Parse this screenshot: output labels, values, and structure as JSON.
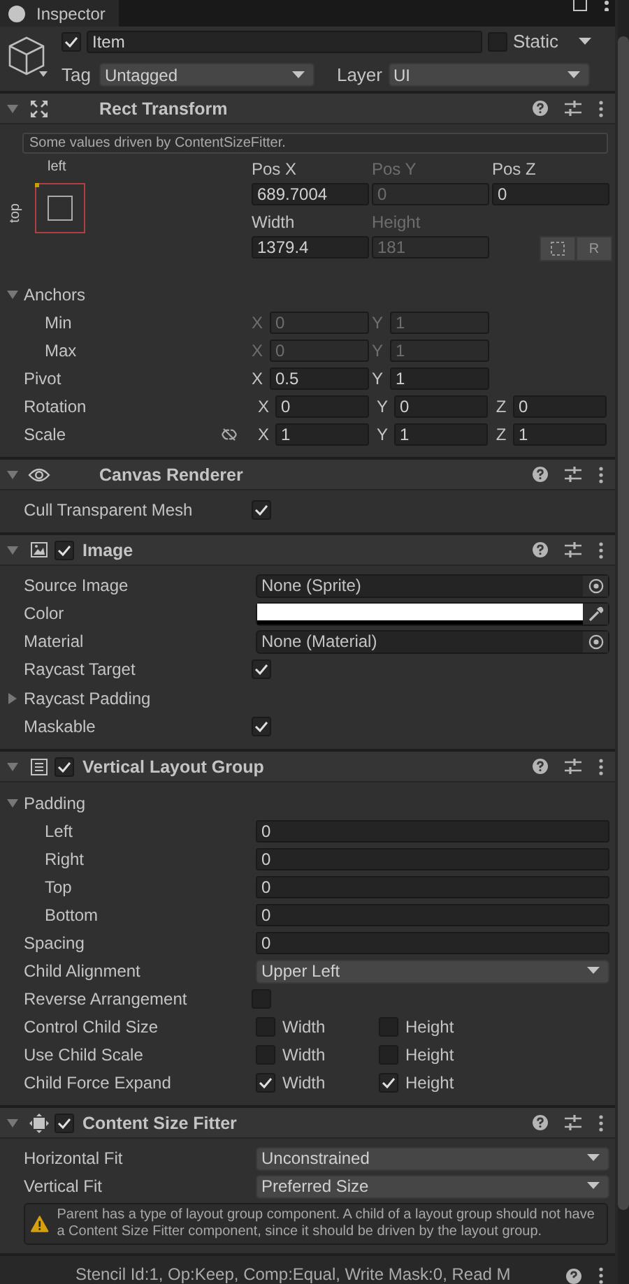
{
  "tab": {
    "label": "Inspector"
  },
  "object": {
    "active": true,
    "name": "Item",
    "static_label": "Static",
    "static": false,
    "tag_label": "Tag",
    "tag": "Untagged",
    "layer_label": "Layer",
    "layer": "UI"
  },
  "components": [
    {
      "title": "Rect Transform",
      "kind": "rect",
      "expanded": true,
      "rows": [
        {
          "kind": "note",
          "text": "Some values driven by ContentSizeFitter."
        },
        {
          "kind": "rect",
          "anchor_h": "left",
          "anchor_v": "top",
          "cells": [
            {
              "label": "Pos X",
              "value": "689.7004",
              "driven": false
            },
            {
              "label": "Pos Y",
              "value": "0",
              "driven": true
            },
            {
              "label": "Pos Z",
              "value": "0",
              "driven": false
            },
            {
              "label": "Width",
              "value": "1379.4",
              "driven": false
            },
            {
              "label": "Height",
              "value": "181",
              "driven": true
            }
          ],
          "raw_button": "R"
        },
        {
          "kind": "foldout",
          "label": "Anchors",
          "expanded": true,
          "children": [
            {
              "kind": "vector",
              "label": "Min",
              "driven": true,
              "values": [
                {
                  "axis": "X",
                  "value": "0"
                },
                {
                  "axis": "Y",
                  "value": "1"
                }
              ]
            },
            {
              "kind": "vector",
              "label": "Max",
              "driven": true,
              "values": [
                {
                  "axis": "X",
                  "value": "0"
                },
                {
                  "axis": "Y",
                  "value": "1"
                }
              ]
            }
          ]
        },
        {
          "kind": "vector",
          "label": "Pivot",
          "driven": false,
          "values": [
            {
              "axis": "X",
              "value": "0.5"
            },
            {
              "axis": "Y",
              "value": "1"
            }
          ]
        },
        {
          "kind": "vector",
          "label": "Rotation",
          "driven": false,
          "values": [
            {
              "axis": "X",
              "value": "0"
            },
            {
              "axis": "Y",
              "value": "0"
            },
            {
              "axis": "Z",
              "value": "0"
            }
          ]
        },
        {
          "kind": "vector",
          "label": "Scale",
          "driven": false,
          "linked": false,
          "values": [
            {
              "axis": "X",
              "value": "1"
            },
            {
              "axis": "Y",
              "value": "1"
            },
            {
              "axis": "Z",
              "value": "1"
            }
          ]
        }
      ]
    },
    {
      "title": "Canvas Renderer",
      "kind": "eye",
      "expanded": true,
      "rows": [
        {
          "kind": "check",
          "label": "Cull Transparent Mesh",
          "checked": true
        }
      ]
    },
    {
      "title": "Image",
      "kind": "image",
      "enabled": true,
      "expanded": true,
      "rows": [
        {
          "kind": "object",
          "label": "Source Image",
          "value": "None (Sprite)"
        },
        {
          "kind": "color",
          "label": "Color",
          "color": "#ffffff"
        },
        {
          "kind": "object",
          "label": "Material",
          "value": "None (Material)"
        },
        {
          "kind": "check",
          "label": "Raycast Target",
          "checked": true
        },
        {
          "kind": "foldout",
          "label": "Raycast Padding",
          "expanded": false,
          "children": []
        },
        {
          "kind": "check",
          "label": "Maskable",
          "checked": true
        }
      ]
    },
    {
      "title": "Vertical Layout Group",
      "kind": "list",
      "enabled": true,
      "expanded": true,
      "rows": [
        {
          "kind": "foldout",
          "label": "Padding",
          "expanded": true,
          "children": [
            {
              "kind": "number",
              "label": "Left",
              "value": "0"
            },
            {
              "kind": "number",
              "label": "Right",
              "value": "0"
            },
            {
              "kind": "number",
              "label": "Top",
              "value": "0"
            },
            {
              "kind": "number",
              "label": "Bottom",
              "value": "0"
            }
          ]
        },
        {
          "kind": "number",
          "label": "Spacing",
          "value": "0"
        },
        {
          "kind": "dropdown",
          "label": "Child Alignment",
          "value": "Upper Left"
        },
        {
          "kind": "check",
          "label": "Reverse Arrangement",
          "checked": false
        },
        {
          "kind": "toggles",
          "label": "Control Child Size",
          "options": [
            {
              "label": "Width",
              "checked": false
            },
            {
              "label": "Height",
              "checked": false
            }
          ]
        },
        {
          "kind": "toggles",
          "label": "Use Child Scale",
          "options": [
            {
              "label": "Width",
              "checked": false
            },
            {
              "label": "Height",
              "checked": false
            }
          ]
        },
        {
          "kind": "toggles",
          "label": "Child Force Expand",
          "options": [
            {
              "label": "Width",
              "checked": true
            },
            {
              "label": "Height",
              "checked": true
            }
          ]
        }
      ]
    },
    {
      "title": "Content Size Fitter",
      "kind": "fitter",
      "enabled": true,
      "expanded": true,
      "rows": [
        {
          "kind": "dropdown",
          "label": "Horizontal Fit",
          "value": "Unconstrained"
        },
        {
          "kind": "dropdown",
          "label": "Vertical Fit",
          "value": "Preferred Size"
        },
        {
          "kind": "warning",
          "text": "Parent has a type of layout group component. A child of a layout group should not have a Content Size Fitter component, since it should be driven by the layout group."
        }
      ]
    }
  ],
  "footer": {
    "text": "Stencil Id:1, Op:Keep, Comp:Equal, Write Mask:0, Read M"
  }
}
